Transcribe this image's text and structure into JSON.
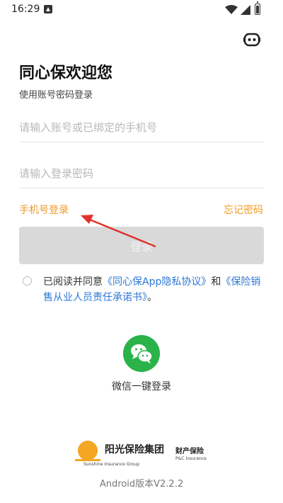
{
  "status_bar": {
    "time": "16:29"
  },
  "header": {
    "title": "同心保欢迎您",
    "subtitle": "使用账号密码登录"
  },
  "form": {
    "account_placeholder": "请输入账号或已绑定的手机号",
    "password_placeholder": "请输入登录密码",
    "phone_login_link": "手机号登录",
    "forgot_password_link": "忘记密码",
    "login_button": "登录"
  },
  "agreement": {
    "prefix": "已阅读并同意",
    "privacy_link": "《同心保App隐私协议》",
    "and": "和",
    "commitment_link": "《保险销售从业人员责任承诺书》",
    "suffix": "。"
  },
  "wechat": {
    "label": "微信一键登录"
  },
  "brand": {
    "name_cn": "阳光保险集团",
    "sub_cn": "财产保险",
    "name_en": "Sunshine Insurance Group",
    "sub_en": "P&C Insurance"
  },
  "footer": {
    "version": "Android版本V2.2.2"
  },
  "colors": {
    "accent_orange": "#f09a2a",
    "link_blue": "#2e78d6",
    "wechat_green": "#2bb34a",
    "disabled_button": "#d9d9d9",
    "annotation_arrow": "#e0312b"
  },
  "icons": [
    "robot-icon",
    "wechat-icon",
    "wifi-icon",
    "signal-icon",
    "battery-icon"
  ]
}
